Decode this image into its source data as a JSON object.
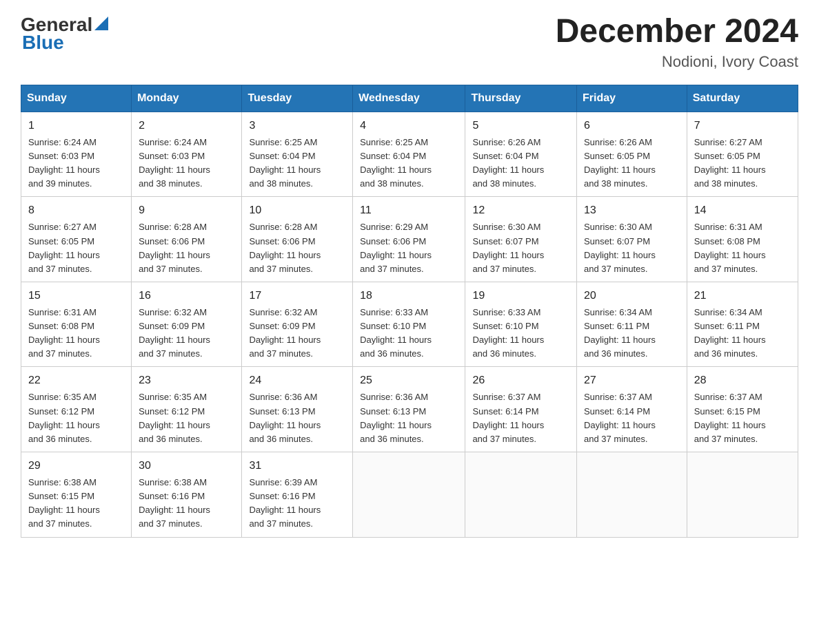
{
  "header": {
    "logo_general": "General",
    "logo_blue": "Blue",
    "month_title": "December 2024",
    "location": "Nodioni, Ivory Coast"
  },
  "days_of_week": [
    "Sunday",
    "Monday",
    "Tuesday",
    "Wednesday",
    "Thursday",
    "Friday",
    "Saturday"
  ],
  "weeks": [
    [
      {
        "day": "1",
        "info": "Sunrise: 6:24 AM\nSunset: 6:03 PM\nDaylight: 11 hours\nand 39 minutes."
      },
      {
        "day": "2",
        "info": "Sunrise: 6:24 AM\nSunset: 6:03 PM\nDaylight: 11 hours\nand 38 minutes."
      },
      {
        "day": "3",
        "info": "Sunrise: 6:25 AM\nSunset: 6:04 PM\nDaylight: 11 hours\nand 38 minutes."
      },
      {
        "day": "4",
        "info": "Sunrise: 6:25 AM\nSunset: 6:04 PM\nDaylight: 11 hours\nand 38 minutes."
      },
      {
        "day": "5",
        "info": "Sunrise: 6:26 AM\nSunset: 6:04 PM\nDaylight: 11 hours\nand 38 minutes."
      },
      {
        "day": "6",
        "info": "Sunrise: 6:26 AM\nSunset: 6:05 PM\nDaylight: 11 hours\nand 38 minutes."
      },
      {
        "day": "7",
        "info": "Sunrise: 6:27 AM\nSunset: 6:05 PM\nDaylight: 11 hours\nand 38 minutes."
      }
    ],
    [
      {
        "day": "8",
        "info": "Sunrise: 6:27 AM\nSunset: 6:05 PM\nDaylight: 11 hours\nand 37 minutes."
      },
      {
        "day": "9",
        "info": "Sunrise: 6:28 AM\nSunset: 6:06 PM\nDaylight: 11 hours\nand 37 minutes."
      },
      {
        "day": "10",
        "info": "Sunrise: 6:28 AM\nSunset: 6:06 PM\nDaylight: 11 hours\nand 37 minutes."
      },
      {
        "day": "11",
        "info": "Sunrise: 6:29 AM\nSunset: 6:06 PM\nDaylight: 11 hours\nand 37 minutes."
      },
      {
        "day": "12",
        "info": "Sunrise: 6:30 AM\nSunset: 6:07 PM\nDaylight: 11 hours\nand 37 minutes."
      },
      {
        "day": "13",
        "info": "Sunrise: 6:30 AM\nSunset: 6:07 PM\nDaylight: 11 hours\nand 37 minutes."
      },
      {
        "day": "14",
        "info": "Sunrise: 6:31 AM\nSunset: 6:08 PM\nDaylight: 11 hours\nand 37 minutes."
      }
    ],
    [
      {
        "day": "15",
        "info": "Sunrise: 6:31 AM\nSunset: 6:08 PM\nDaylight: 11 hours\nand 37 minutes."
      },
      {
        "day": "16",
        "info": "Sunrise: 6:32 AM\nSunset: 6:09 PM\nDaylight: 11 hours\nand 37 minutes."
      },
      {
        "day": "17",
        "info": "Sunrise: 6:32 AM\nSunset: 6:09 PM\nDaylight: 11 hours\nand 37 minutes."
      },
      {
        "day": "18",
        "info": "Sunrise: 6:33 AM\nSunset: 6:10 PM\nDaylight: 11 hours\nand 36 minutes."
      },
      {
        "day": "19",
        "info": "Sunrise: 6:33 AM\nSunset: 6:10 PM\nDaylight: 11 hours\nand 36 minutes."
      },
      {
        "day": "20",
        "info": "Sunrise: 6:34 AM\nSunset: 6:11 PM\nDaylight: 11 hours\nand 36 minutes."
      },
      {
        "day": "21",
        "info": "Sunrise: 6:34 AM\nSunset: 6:11 PM\nDaylight: 11 hours\nand 36 minutes."
      }
    ],
    [
      {
        "day": "22",
        "info": "Sunrise: 6:35 AM\nSunset: 6:12 PM\nDaylight: 11 hours\nand 36 minutes."
      },
      {
        "day": "23",
        "info": "Sunrise: 6:35 AM\nSunset: 6:12 PM\nDaylight: 11 hours\nand 36 minutes."
      },
      {
        "day": "24",
        "info": "Sunrise: 6:36 AM\nSunset: 6:13 PM\nDaylight: 11 hours\nand 36 minutes."
      },
      {
        "day": "25",
        "info": "Sunrise: 6:36 AM\nSunset: 6:13 PM\nDaylight: 11 hours\nand 36 minutes."
      },
      {
        "day": "26",
        "info": "Sunrise: 6:37 AM\nSunset: 6:14 PM\nDaylight: 11 hours\nand 37 minutes."
      },
      {
        "day": "27",
        "info": "Sunrise: 6:37 AM\nSunset: 6:14 PM\nDaylight: 11 hours\nand 37 minutes."
      },
      {
        "day": "28",
        "info": "Sunrise: 6:37 AM\nSunset: 6:15 PM\nDaylight: 11 hours\nand 37 minutes."
      }
    ],
    [
      {
        "day": "29",
        "info": "Sunrise: 6:38 AM\nSunset: 6:15 PM\nDaylight: 11 hours\nand 37 minutes."
      },
      {
        "day": "30",
        "info": "Sunrise: 6:38 AM\nSunset: 6:16 PM\nDaylight: 11 hours\nand 37 minutes."
      },
      {
        "day": "31",
        "info": "Sunrise: 6:39 AM\nSunset: 6:16 PM\nDaylight: 11 hours\nand 37 minutes."
      },
      null,
      null,
      null,
      null
    ]
  ]
}
